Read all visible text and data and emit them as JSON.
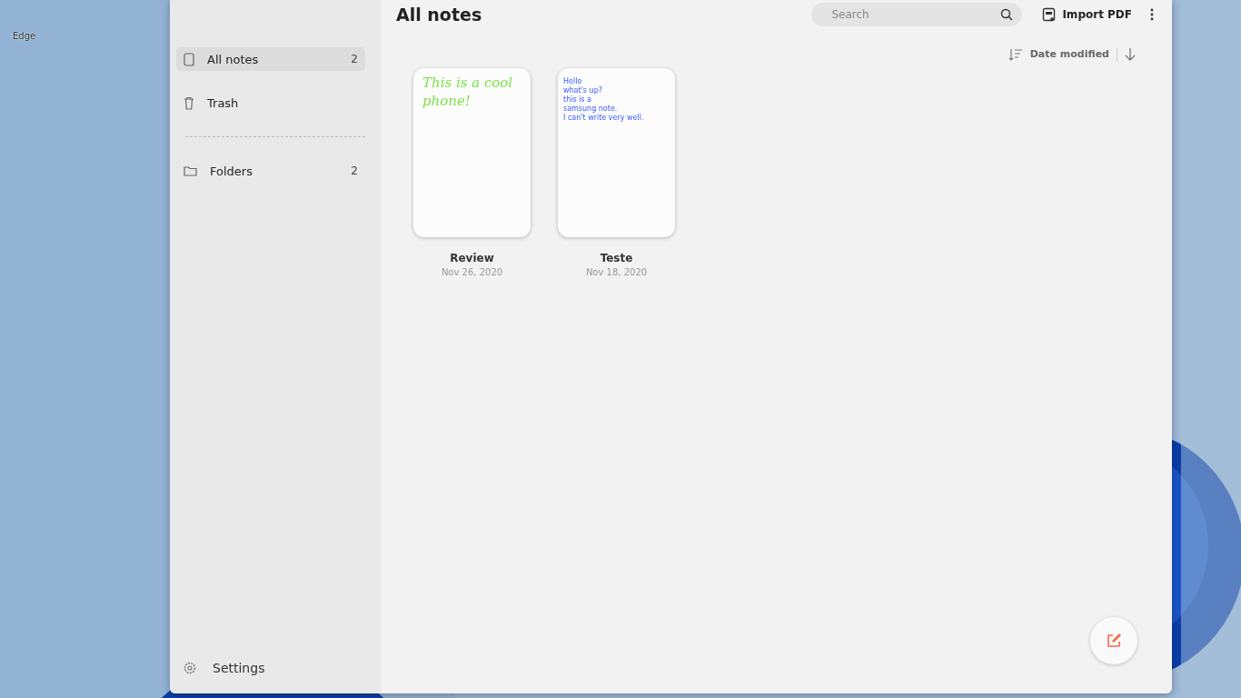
{
  "desktop": {
    "icons": [
      {
        "label": "Edge"
      }
    ]
  },
  "window": {
    "title": "All notes",
    "search": {
      "placeholder": "Search"
    },
    "toolbar": {
      "import_label": "Import PDF"
    },
    "sidebar": {
      "items": [
        {
          "label": "All notes",
          "count": "2",
          "kind": "note",
          "selected": true
        },
        {
          "label": "Trash",
          "kind": "trash",
          "selected": false
        },
        {
          "kind": "divider"
        },
        {
          "label": "Folders",
          "count": "2",
          "kind": "folder",
          "selected": false
        }
      ],
      "settings_label": "Settings"
    },
    "sort": {
      "label": "Date modified"
    },
    "notes": [
      {
        "title": "Review",
        "date": "Nov 26, 2020",
        "kind": "handwriting",
        "lines": [
          "This is a cool",
          "phone!"
        ]
      },
      {
        "title": "Teste",
        "date": "Nov 18, 2020",
        "kind": "typed",
        "lines": [
          "Hello",
          "what's up?",
          "this is a",
          "samsung note.",
          "I can't write very well."
        ]
      }
    ]
  }
}
